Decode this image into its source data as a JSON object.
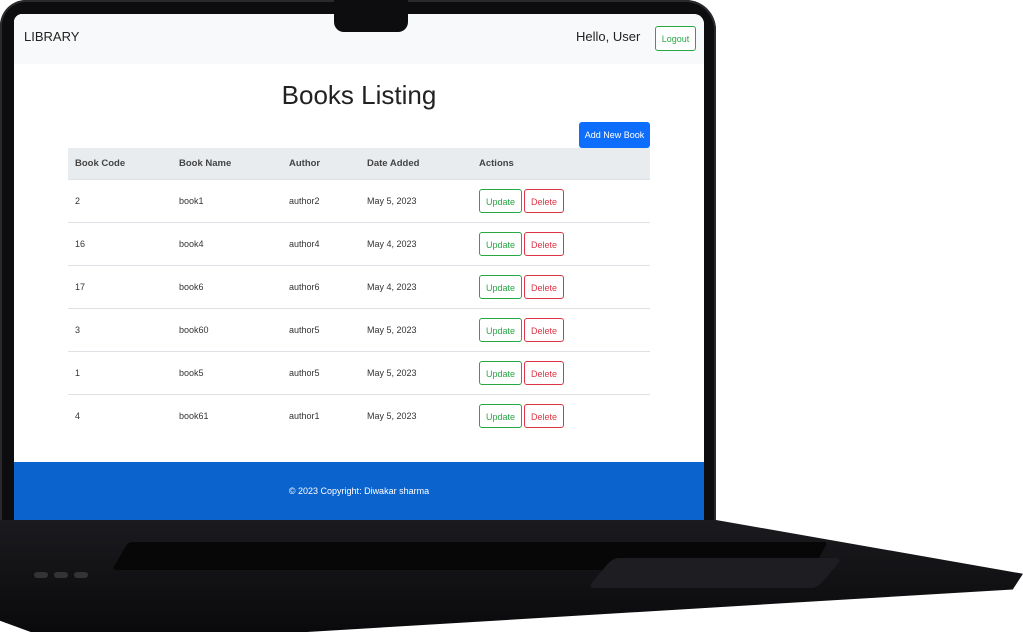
{
  "navbar": {
    "brand": "LIBRARY",
    "greeting": "Hello, User",
    "logout_label": "Logout"
  },
  "page": {
    "title": "Books Listing",
    "add_button": "Add New Book"
  },
  "table": {
    "headers": [
      "Book Code",
      "Book Name",
      "Author",
      "Date Added",
      "Actions"
    ],
    "rows": [
      {
        "code": "2",
        "name": "book1",
        "author": "author2",
        "date": "May 5, 2023"
      },
      {
        "code": "16",
        "name": "book4",
        "author": "author4",
        "date": "May 4, 2023"
      },
      {
        "code": "17",
        "name": "book6",
        "author": "author6",
        "date": "May 4, 2023"
      },
      {
        "code": "3",
        "name": "book60",
        "author": "author5",
        "date": "May 5, 2023"
      },
      {
        "code": "1",
        "name": "book5",
        "author": "author5",
        "date": "May 5, 2023"
      },
      {
        "code": "4",
        "name": "book61",
        "author": "author1",
        "date": "May 5, 2023"
      }
    ],
    "update_label": "Update",
    "delete_label": "Delete"
  },
  "footer": {
    "text": "© 2023 Copyright: Diwakar sharma"
  },
  "colors": {
    "primary": "#0d6efd",
    "success": "#28a745",
    "danger": "#dc3545",
    "footer_bg": "#0b63ce"
  }
}
